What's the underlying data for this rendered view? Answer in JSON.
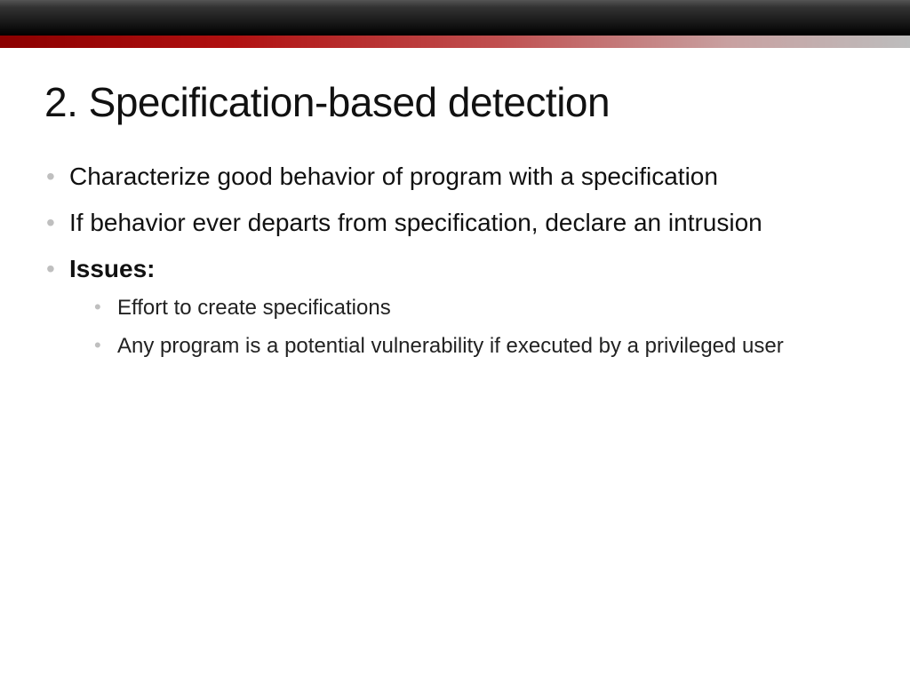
{
  "slide": {
    "title": "2. Specification-based detection",
    "bullets": {
      "b1": "Characterize good behavior of program with a specification",
      "b2": "If behavior ever departs from specification, declare an intrusion",
      "b3": "Issues:",
      "sub": {
        "s1": "Effort to create specifications",
        "s2": "Any program is a potential vulnerability if executed by a privileged user"
      }
    }
  }
}
